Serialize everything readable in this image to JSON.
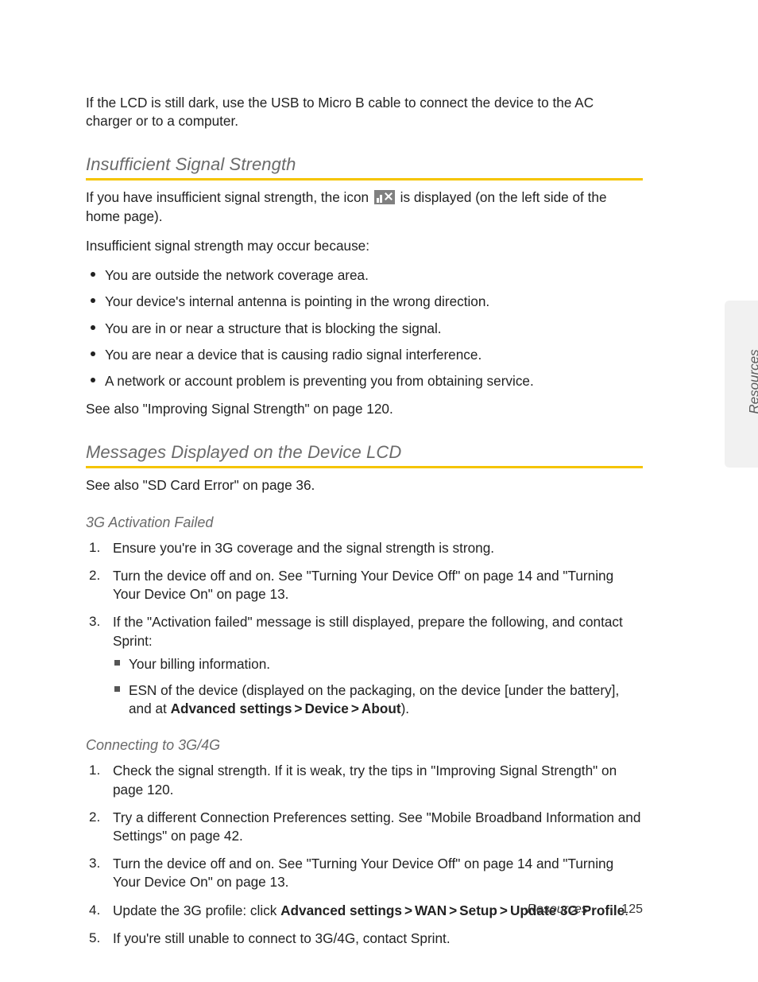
{
  "sideTab": "Resources",
  "intro": "If the LCD is still dark, use the USB to Micro B cable to connect the device to the AC charger or to a computer.",
  "sections": {
    "s1": {
      "heading": "Insufficient Signal Strength",
      "para1a": "If you have insufficient signal strength, the icon ",
      "para1b": " is displayed (on the left side of the home page).",
      "para2": "Insufficient signal strength may occur because:",
      "bullets": [
        "You are outside the network coverage area.",
        "Your device's internal antenna is pointing in the wrong direction.",
        "You are in or near a structure that is blocking the signal.",
        "You are near a device that is causing radio signal interference.",
        "A network or account problem is preventing you from obtaining service."
      ],
      "seeAlso": "See also \"Improving Signal Strength\" on page 120."
    },
    "s2": {
      "heading": "Messages Displayed on the Device LCD",
      "seeAlso": "See also \"SD Card Error\" on page 36.",
      "sub1": {
        "heading": "3G Activation Failed",
        "steps": [
          "Ensure you're in 3G coverage and the signal strength is strong.",
          "Turn the device off and on. See \"Turning Your Device Off\" on page 14 and \"Turning Your Device On\" on page 13.",
          "If the \"Activation failed\" message is still displayed, prepare the following, and contact Sprint:"
        ],
        "sub3a": "Your billing information.",
        "sub3b_pre": "ESN of the device (displayed on the packaging, on the device [under the battery], and at ",
        "sub3b_b1": "Advanced settings",
        "sub3b_b2": "Device",
        "sub3b_b3": "About",
        "sub3b_post": ")."
      },
      "sub2": {
        "heading": "Connecting to 3G/4G",
        "steps": [
          "Check the signal strength. If it is weak, try the tips in \"Improving Signal Strength\" on page 120.",
          "Try a different Connection Preferences setting. See \"Mobile Broadband Information and Settings\" on page 42.",
          "Turn the device off and on. See \"Turning Your Device Off\" on page 14 and \"Turning Your Device On\" on page 13."
        ],
        "step4_pre": "Update the 3G profile: click ",
        "step4_b1": "Advanced settings",
        "step4_b2": "WAN",
        "step4_b3": "Setup",
        "step4_b4": "Update 3G Profile",
        "step4_post": ".",
        "step5": "If you're still unable to connect to 3G/4G, contact Sprint."
      }
    }
  },
  "footer": {
    "section": "Resources",
    "page": "125"
  }
}
